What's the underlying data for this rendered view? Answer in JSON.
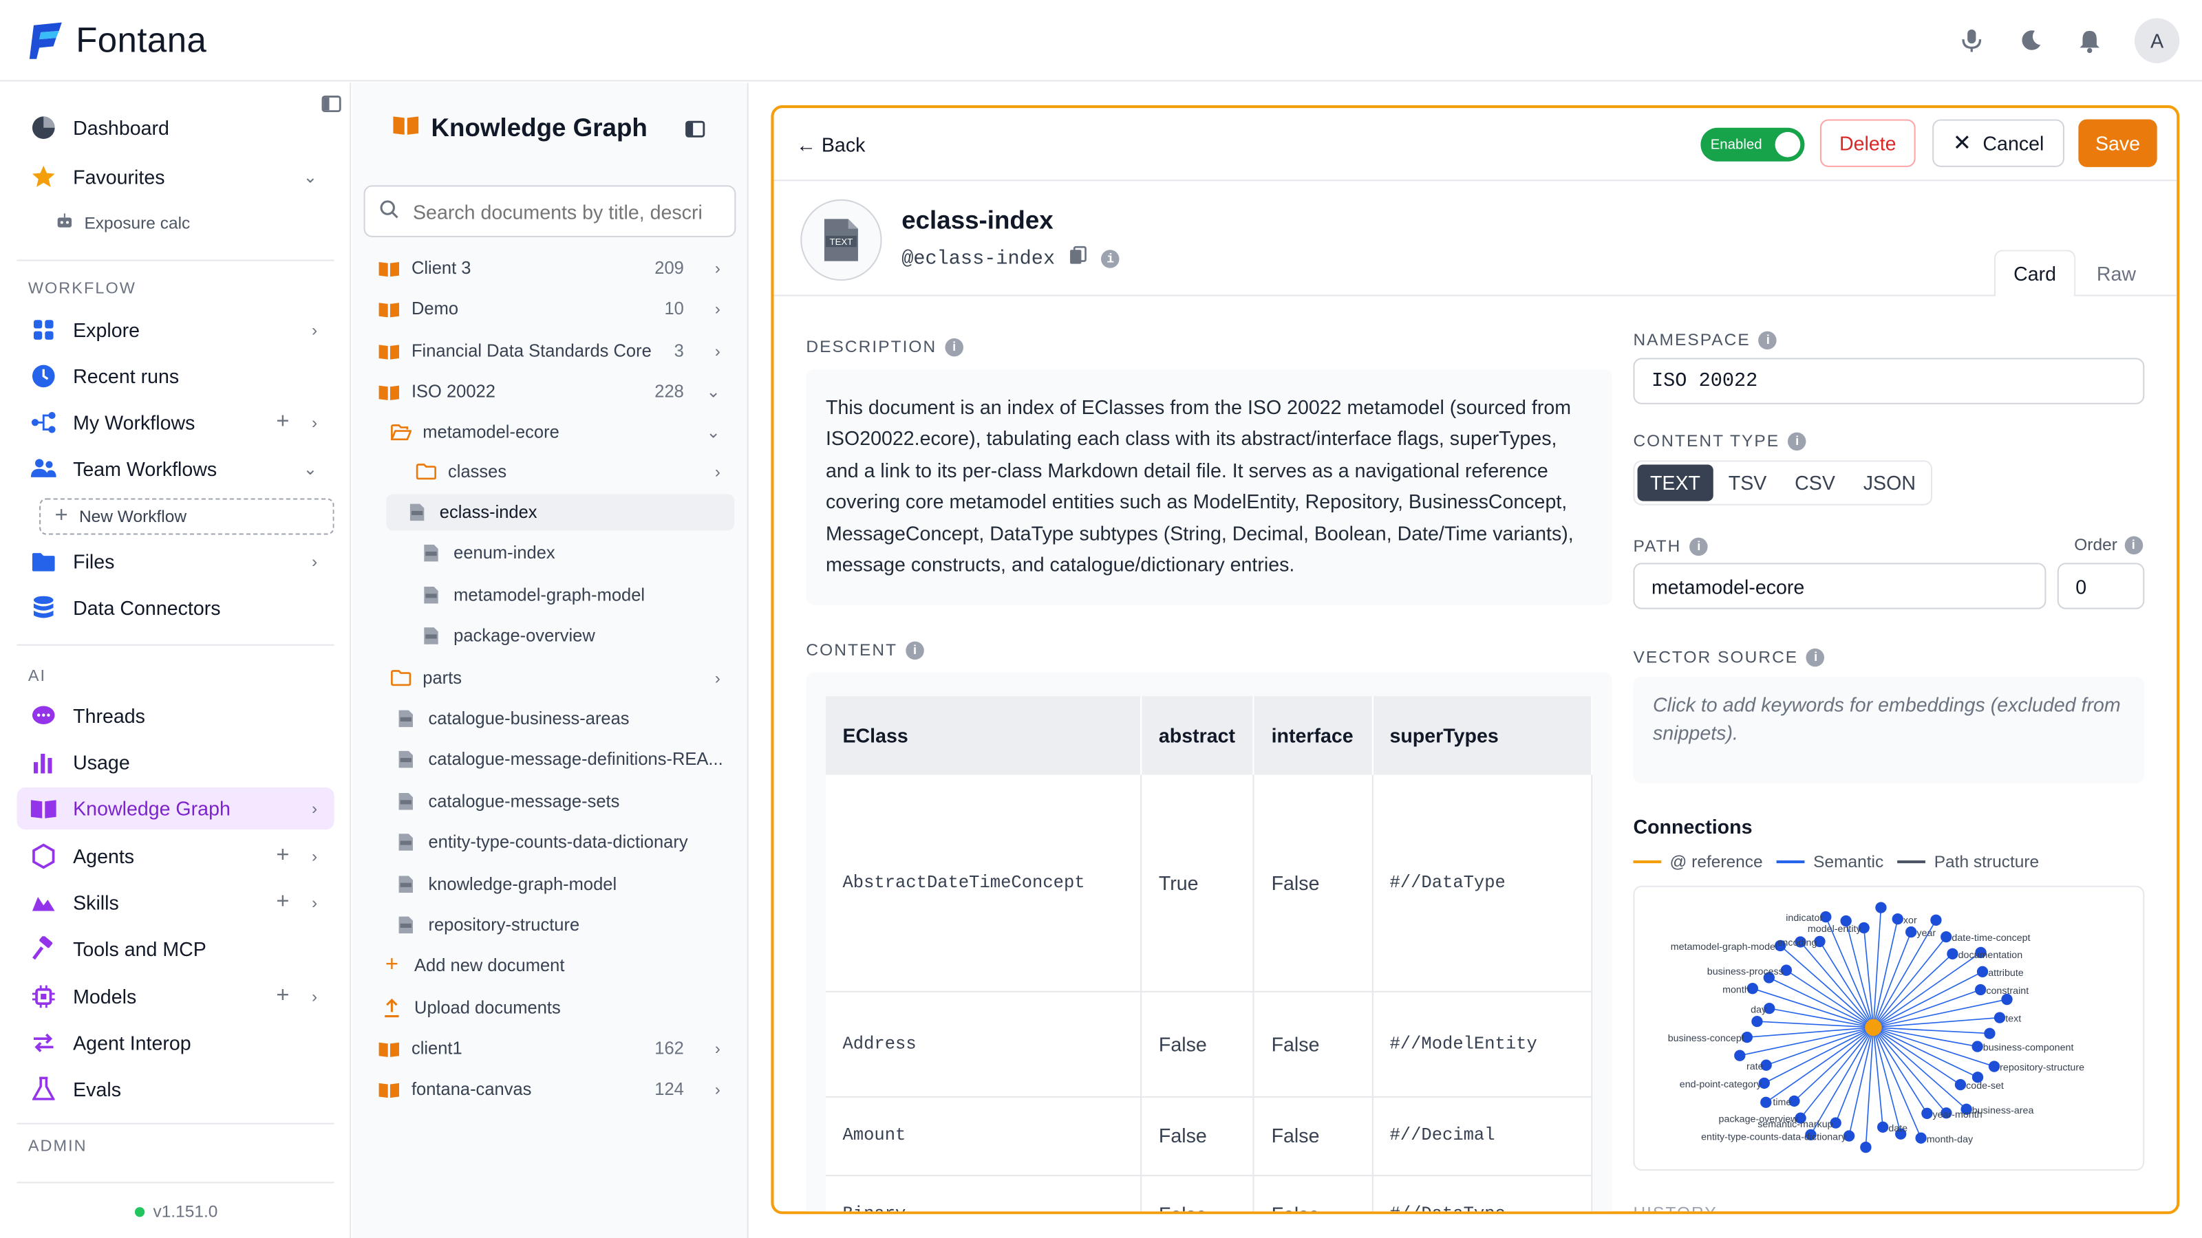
{
  "app": {
    "name": "Fontana"
  },
  "header": {
    "avatar": "A"
  },
  "sidebar": {
    "items": [
      {
        "label": "Dashboard"
      },
      {
        "label": "Favourites"
      }
    ],
    "favourite_sub": "Exposure calc",
    "workflow_section": "WORKFLOW",
    "workflow": [
      {
        "label": "Explore"
      },
      {
        "label": "Recent runs"
      },
      {
        "label": "My Workflows"
      },
      {
        "label": "Team Workflows"
      }
    ],
    "new_workflow": "New Workflow",
    "files": "Files",
    "data_connectors": "Data Connectors",
    "ai_section": "AI",
    "ai": [
      {
        "label": "Threads"
      },
      {
        "label": "Usage"
      },
      {
        "label": "Knowledge Graph"
      },
      {
        "label": "Agents"
      },
      {
        "label": "Skills"
      },
      {
        "label": "Tools and MCP"
      },
      {
        "label": "Models"
      },
      {
        "label": "Agent Interop"
      },
      {
        "label": "Evals"
      }
    ],
    "admin_section": "ADMIN",
    "version": "v1.151.0"
  },
  "docs": {
    "title": "Knowledge Graph",
    "search_placeholder": "Search documents by title, descri",
    "tree": [
      {
        "label": "Client 3",
        "count": "209"
      },
      {
        "label": "Demo",
        "count": "10"
      },
      {
        "label": "Financial Data Standards Core",
        "count": "3"
      },
      {
        "label": "ISO 20022",
        "count": "228"
      },
      {
        "label": "metamodel-ecore"
      },
      {
        "label": "classes"
      },
      {
        "label": "eclass-index"
      },
      {
        "label": "eenum-index"
      },
      {
        "label": "metamodel-graph-model"
      },
      {
        "label": "package-overview"
      },
      {
        "label": "parts"
      },
      {
        "label": "catalogue-business-areas"
      },
      {
        "label": "catalogue-message-definitions-REA..."
      },
      {
        "label": "catalogue-message-sets"
      },
      {
        "label": "entity-type-counts-data-dictionary"
      },
      {
        "label": "knowledge-graph-model"
      },
      {
        "label": "repository-structure"
      },
      {
        "label": "Add new document"
      },
      {
        "label": "Upload documents"
      },
      {
        "label": "client1",
        "count": "162"
      },
      {
        "label": "fontana-canvas",
        "count": "124"
      }
    ]
  },
  "editor": {
    "back": "Back",
    "enabled": "Enabled",
    "delete": "Delete",
    "cancel": "Cancel",
    "save": "Save",
    "icon_text": "TEXT",
    "name": "eclass-index",
    "slug": "@eclass-index",
    "tabs": [
      "Card",
      "Raw"
    ],
    "description_label": "DESCRIPTION",
    "description": "This document is an index of EClasses from the ISO 20022 metamodel (sourced from ISO20022.ecore), tabulating each class with its abstract/interface flags, superTypes, and a link to its per-class Markdown detail file. It serves as a navigational reference covering core metamodel entities such as ModelEntity, Repository, BusinessConcept, MessageConcept, DataType subtypes (String, Decimal, Boolean, Date/Time variants), message constructs, and catalogue/dictionary entries.",
    "content_label": "CONTENT",
    "table": {
      "headers": [
        "EClass",
        "abstract",
        "interface",
        "superTypes"
      ],
      "rows": [
        [
          "AbstractDateTimeConcept",
          "True",
          "False",
          "#//DataType"
        ],
        [
          "Address",
          "False",
          "False",
          "#//ModelEntity"
        ],
        [
          "Amount",
          "False",
          "False",
          "#//Decimal"
        ],
        [
          "Binary",
          "False",
          "False",
          "#//DataType"
        ]
      ]
    },
    "namespace_label": "NAMESPACE",
    "namespace": "ISO 20022",
    "content_type_label": "CONTENT TYPE",
    "content_types": [
      "TEXT",
      "TSV",
      "CSV",
      "JSON"
    ],
    "path_label": "PATH",
    "path": "metamodel-ecore",
    "order_label": "Order",
    "order": "0",
    "vector_label": "VECTOR SOURCE",
    "vector_placeholder": "Click to add keywords for embeddings (excluded from snippets).",
    "connections_title": "Connections",
    "legend": [
      {
        "label": "@ reference",
        "color": "#f59e0b"
      },
      {
        "label": "Semantic",
        "color": "#2563eb"
      },
      {
        "label": "Path structure",
        "color": "#4b5563"
      }
    ],
    "graph_labels": [
      "business-component",
      "repository-structure",
      "code-set",
      "business-area",
      "year-month",
      "month-day",
      "date",
      "entity-type-counts-data-dictionary",
      "semantic-markup",
      "package-overview",
      "time",
      "end-point-category",
      "rate",
      "business-concept",
      "day",
      "month",
      "business-process",
      "metamodel-graph-model",
      "encoding",
      "indicator",
      "model-entity",
      "xor",
      "year",
      "date-time-concept",
      "documentation",
      "attribute",
      "constraint",
      "text"
    ],
    "next_label": "HISTORY"
  }
}
